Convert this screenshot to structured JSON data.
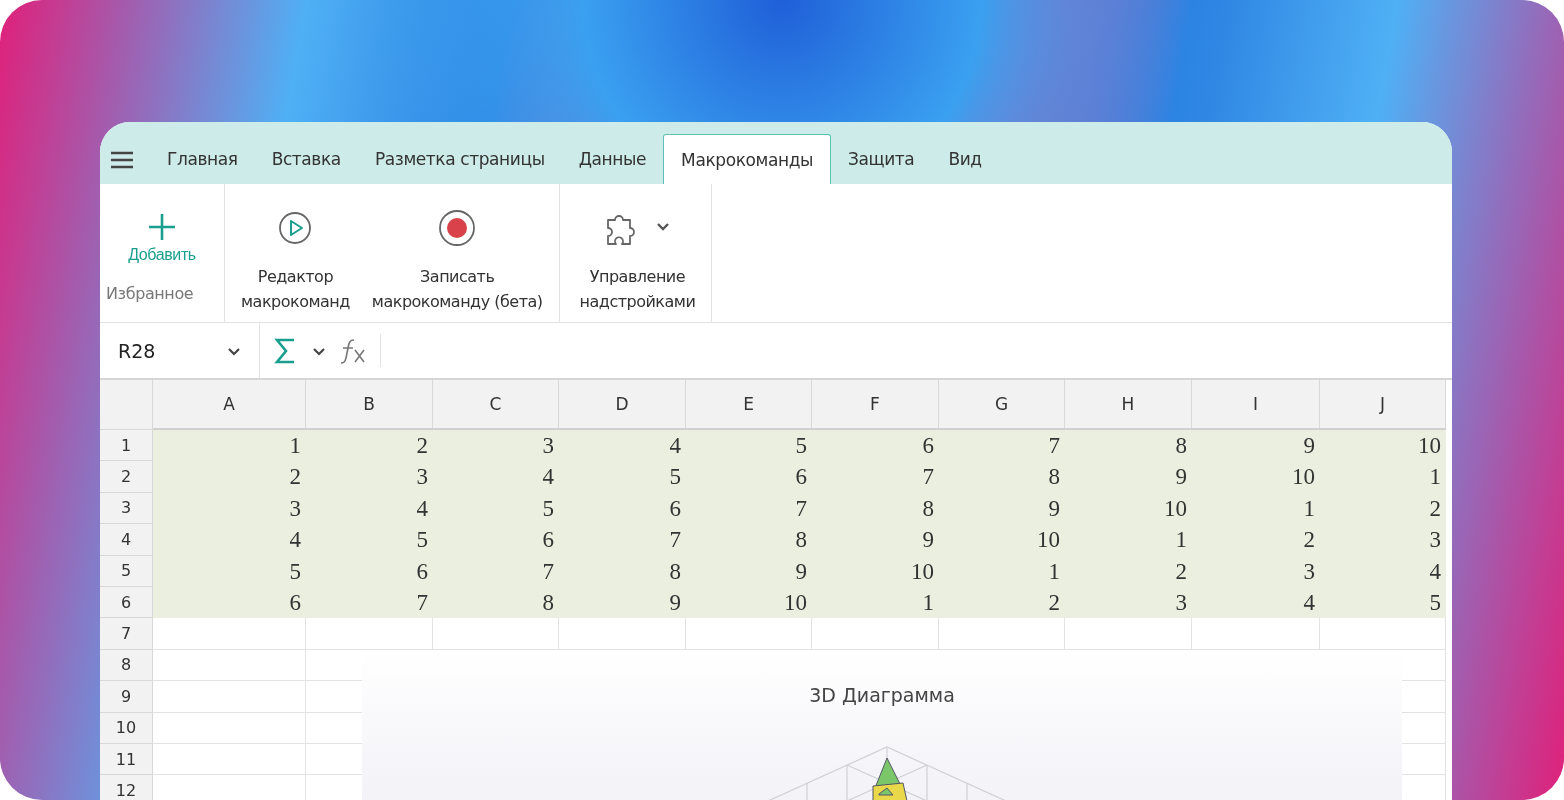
{
  "menu_tabs": [
    {
      "label": "Главная",
      "selected": false
    },
    {
      "label": "Вставка",
      "selected": false
    },
    {
      "label": "Разметка страницы",
      "selected": false
    },
    {
      "label": "Данные",
      "selected": false
    },
    {
      "label": "Макрокоманды",
      "selected": true
    },
    {
      "label": "Защита",
      "selected": false
    },
    {
      "label": "Вид",
      "selected": false
    }
  ],
  "ribbon": {
    "favorites": {
      "add_label": "Добавить",
      "group_label": "Избранное"
    },
    "commands": [
      {
        "kind": "play",
        "label": "Редактор\nмакрокоманд"
      },
      {
        "kind": "record",
        "label": "Записать\nмакрокоманду (бета)"
      },
      {
        "kind": "addins",
        "label": "Управление\nнадстройками"
      }
    ]
  },
  "formula_bar": {
    "cell_reference": "R28"
  },
  "sheet": {
    "columns": [
      "A",
      "B",
      "C",
      "D",
      "E",
      "F",
      "G",
      "H",
      "I",
      "J"
    ],
    "rows": [
      {
        "number": "1",
        "highlighted": true,
        "cells": [
          "1",
          "2",
          "3",
          "4",
          "5",
          "6",
          "7",
          "8",
          "9",
          "10"
        ]
      },
      {
        "number": "2",
        "highlighted": true,
        "cells": [
          "2",
          "3",
          "4",
          "5",
          "6",
          "7",
          "8",
          "9",
          "10",
          "1"
        ]
      },
      {
        "number": "3",
        "highlighted": true,
        "cells": [
          "3",
          "4",
          "5",
          "6",
          "7",
          "8",
          "9",
          "10",
          "1",
          "2"
        ]
      },
      {
        "number": "4",
        "highlighted": true,
        "cells": [
          "4",
          "5",
          "6",
          "7",
          "8",
          "9",
          "10",
          "1",
          "2",
          "3"
        ]
      },
      {
        "number": "5",
        "highlighted": true,
        "cells": [
          "5",
          "6",
          "7",
          "8",
          "9",
          "10",
          "1",
          "2",
          "3",
          "4"
        ]
      },
      {
        "number": "6",
        "highlighted": true,
        "cells": [
          "6",
          "7",
          "8",
          "9",
          "10",
          "1",
          "2",
          "3",
          "4",
          "5"
        ]
      },
      {
        "number": "7",
        "highlighted": false,
        "cells": []
      },
      {
        "number": "8",
        "highlighted": false,
        "cells": []
      },
      {
        "number": "9",
        "highlighted": false,
        "cells": []
      },
      {
        "number": "10",
        "highlighted": false,
        "cells": []
      },
      {
        "number": "11",
        "highlighted": false,
        "cells": []
      },
      {
        "number": "12",
        "highlighted": false,
        "cells": []
      }
    ]
  },
  "chart": {
    "title": "3D Диаграмма"
  }
}
